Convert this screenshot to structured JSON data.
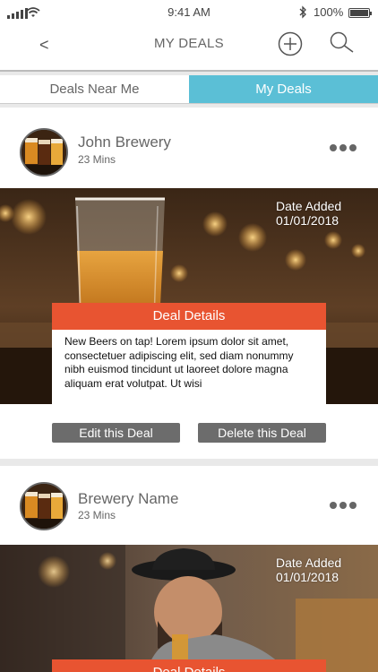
{
  "status_bar": {
    "time": "9:41 AM",
    "battery_percent": "100%"
  },
  "nav": {
    "back_label": "<",
    "title": "MY DEALS"
  },
  "tabs": [
    {
      "label": "Deals Near Me",
      "active": false
    },
    {
      "label": "My Deals",
      "active": true
    }
  ],
  "colors": {
    "accent": "#5bbfd6",
    "deal_header": "#e85431",
    "button": "#6c6c6c"
  },
  "deals": [
    {
      "brewery": "John Brewery",
      "time_ago": "23 Mins",
      "date_added_label": "Date Added",
      "date_added": "01/01/2018",
      "deal_title": "Deal Details",
      "deal_text": "New Beers on tap! Lorem ipsum dolor sit amet, consectetuer adipiscing elit, sed diam nonummy nibh euismod tincidunt ut laoreet dolore magna aliquam erat volutpat. Ut wisi",
      "edit_label": "Edit this Deal",
      "delete_label": "Delete this Deal"
    },
    {
      "brewery": "Brewery Name",
      "time_ago": "23 Mins",
      "date_added_label": "Date Added",
      "date_added": "01/01/2018",
      "deal_title": "Deal Details"
    }
  ]
}
